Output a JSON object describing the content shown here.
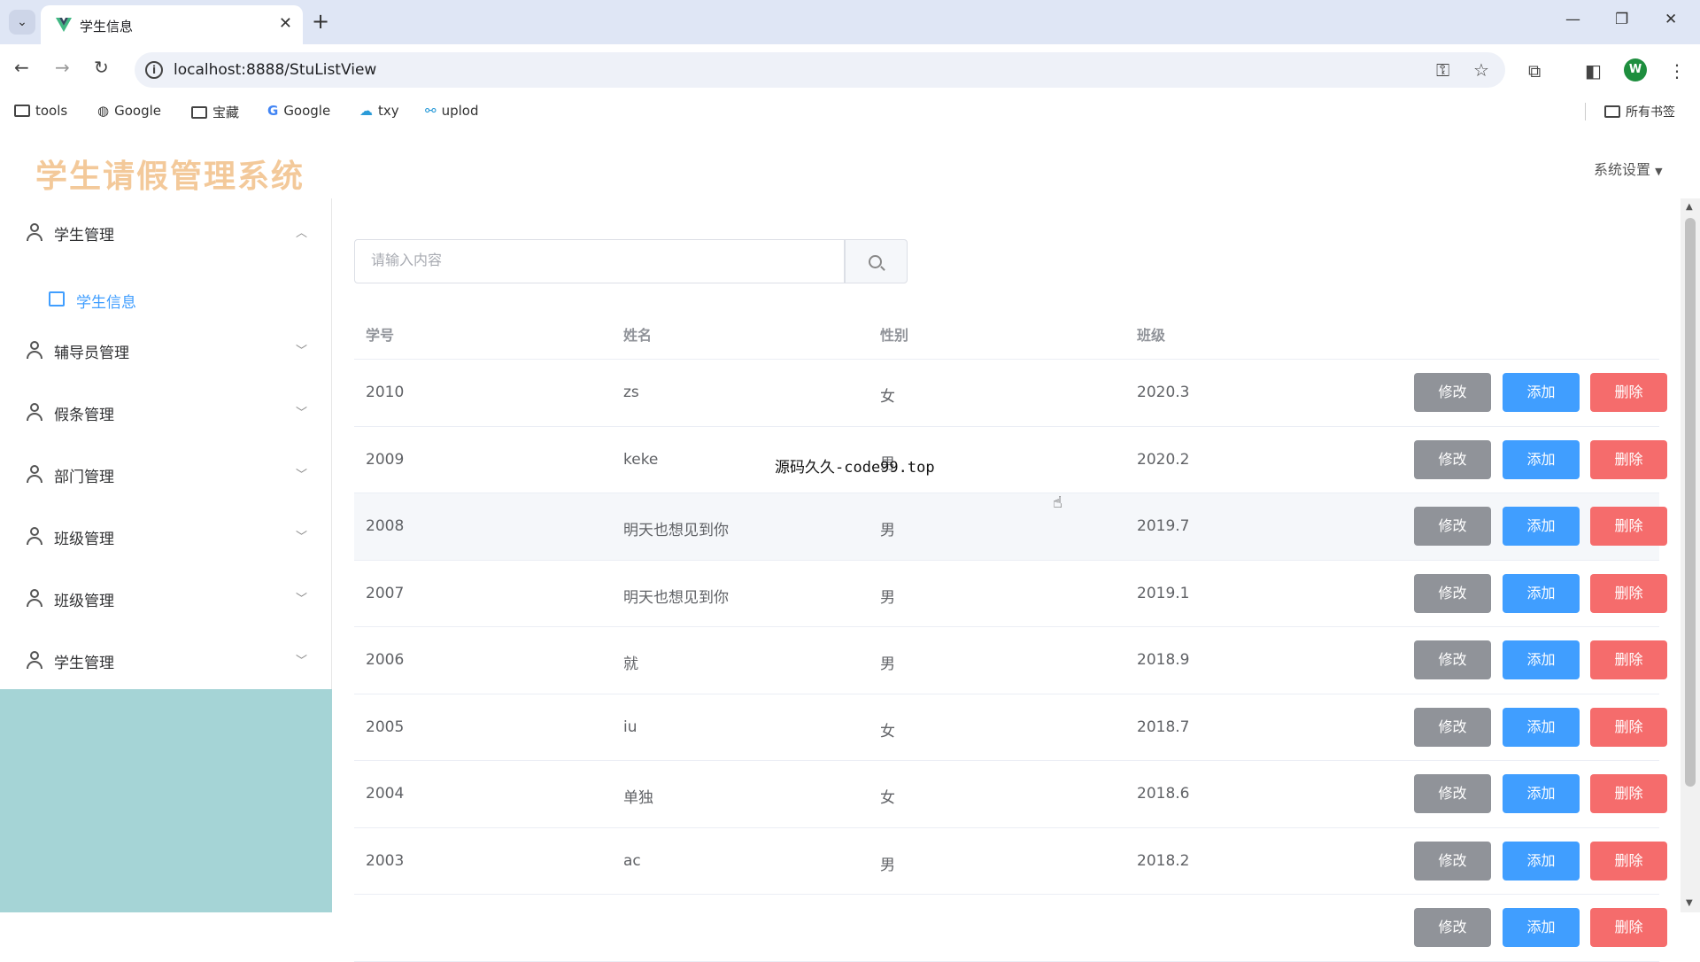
{
  "browser": {
    "tab_title": "学生信息",
    "url": "localhost:8888/StuListView",
    "bookmarks": [
      {
        "label": "tools",
        "icon": "folder-icon"
      },
      {
        "label": "Google",
        "icon": "globe-icon"
      },
      {
        "label": "宝藏",
        "icon": "folder-icon"
      },
      {
        "label": "Google",
        "icon": "google-icon"
      },
      {
        "label": "txy",
        "icon": "cloud-icon"
      },
      {
        "label": "uplod",
        "icon": "share-icon"
      }
    ],
    "all_bookmarks": "所有书签",
    "profile_initial": "W"
  },
  "header": {
    "logo_text": "学生请假管理系统",
    "settings_label": "系统设置"
  },
  "sidebar": {
    "items": [
      {
        "label": "学生管理",
        "expanded": true,
        "children": [
          {
            "label": "学生信息"
          }
        ]
      },
      {
        "label": "辅导员管理"
      },
      {
        "label": "假条管理"
      },
      {
        "label": "部门管理"
      },
      {
        "label": "班级管理"
      },
      {
        "label": "班级管理"
      },
      {
        "label": "学生管理"
      }
    ]
  },
  "search": {
    "placeholder": "请输入内容"
  },
  "table": {
    "columns": [
      "学号",
      "姓名",
      "性别",
      "班级"
    ],
    "actions": {
      "edit": "修改",
      "add": "添加",
      "delete": "删除"
    },
    "rows": [
      {
        "id": "2010",
        "name": "zs",
        "gender": "女",
        "class": "2020.3"
      },
      {
        "id": "2009",
        "name": "keke",
        "gender": "男",
        "class": "2020.2"
      },
      {
        "id": "2008",
        "name": "明天也想见到你",
        "gender": "男",
        "class": "2019.7"
      },
      {
        "id": "2007",
        "name": "明天也想见到你",
        "gender": "男",
        "class": "2019.1"
      },
      {
        "id": "2006",
        "name": "就",
        "gender": "男",
        "class": "2018.9"
      },
      {
        "id": "2005",
        "name": "iu",
        "gender": "女",
        "class": "2018.7"
      },
      {
        "id": "2004",
        "name": "单独",
        "gender": "女",
        "class": "2018.6"
      },
      {
        "id": "2003",
        "name": "ac",
        "gender": "男",
        "class": "2018.2"
      },
      {
        "id": "",
        "name": "",
        "gender": "",
        "class": ""
      }
    ]
  },
  "overlay_text": "源码久久-code99.top",
  "colors": {
    "primary": "#409eff",
    "danger": "#f56c6c",
    "info": "#909399",
    "sidebar_fill": "#a5d4d6",
    "logo": "#f3c99a"
  }
}
